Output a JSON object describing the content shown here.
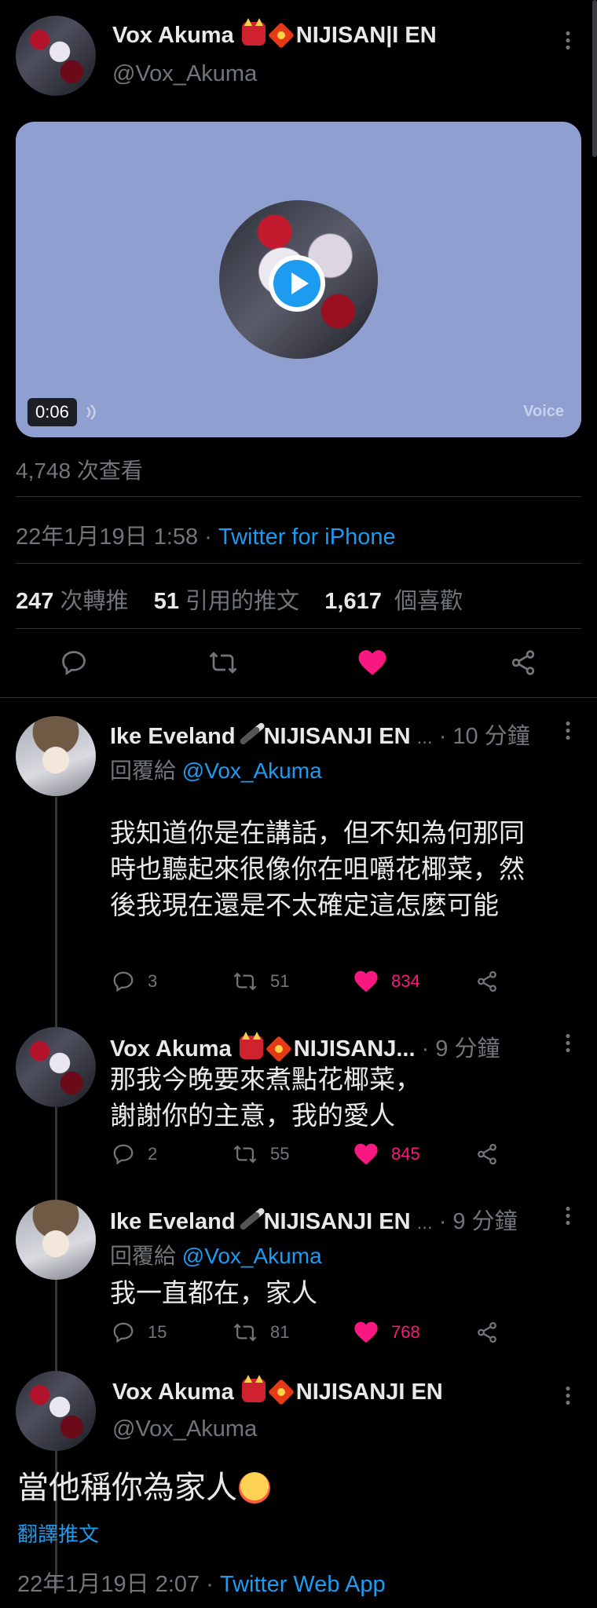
{
  "main_tweet": {
    "author_name": "Vox Akuma",
    "author_suffix": "NIJISAN|I EN",
    "handle": "@Vox_Akuma",
    "media": {
      "duration": "0:06",
      "tag": "Voice",
      "bg_color": "#8e9fd0"
    },
    "views": "4,748 次查看",
    "timestamp": "22年1月19日 1:58",
    "separator": "·",
    "source": "Twitter for iPhone",
    "stats": {
      "retweets_count": "247",
      "retweets_label": "次轉推",
      "quotes_count": "51",
      "quotes_label": "引用的推文",
      "likes_count": "1,617",
      "likes_label": "個喜歡"
    },
    "liked": true
  },
  "replies": [
    {
      "author_name": "Ike Eveland",
      "author_suffix": "NIJISANJI EN",
      "ellipsis": "...",
      "time": "· 10 分鐘",
      "reply_to_label": "回覆給",
      "reply_to_handle": "@Vox_Akuma",
      "lines": [
        "我知道你是在講話，但不知為何那同",
        "時也聽起來很像你在咀嚼花椰菜，然",
        "後我現在還是不太確定這怎麼可能"
      ],
      "replies": "3",
      "retweets": "51",
      "likes": "834"
    },
    {
      "author_name": "Vox Akuma",
      "author_suffix": "NIJISANJ...",
      "time": "· 9 分鐘",
      "lines": [
        "那我今晚要來煮點花椰菜，",
        "謝謝你的主意，我的愛人"
      ],
      "replies": "2",
      "retweets": "55",
      "likes": "845"
    },
    {
      "author_name": "Ike Eveland",
      "author_suffix": "NIJISANJI EN",
      "ellipsis": "...",
      "time": "· 9 分鐘",
      "reply_to_label": "回覆給",
      "reply_to_handle": "@Vox_Akuma",
      "lines": [
        "我一直都在，家人"
      ],
      "replies": "15",
      "retweets": "81",
      "likes": "768"
    }
  ],
  "final_tweet": {
    "author_name": "Vox Akuma",
    "author_suffix": "NIJISANJI EN",
    "handle": "@Vox_Akuma",
    "text": "當他稱你為家人",
    "translate": "翻譯推文",
    "timestamp": "22年1月19日 2:07",
    "separator": "·",
    "source": "Twitter Web App"
  },
  "colors": {
    "accent": "#1d9bf0",
    "like": "#f91880",
    "muted": "#71767b"
  },
  "icons": [
    "more-icon",
    "play-icon",
    "sound-icon",
    "reply-icon",
    "retweet-icon",
    "heart-icon",
    "share-icon"
  ]
}
